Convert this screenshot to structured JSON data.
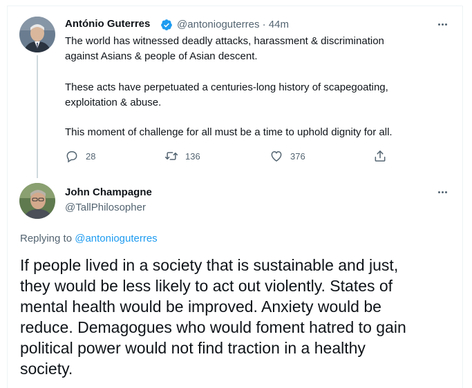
{
  "original_tweet": {
    "author_name": "António Guterres",
    "verified": true,
    "handle_time": "@antonioguterres · 44m",
    "body_lines": [
      "The world has witnessed deadly attacks, harassment & discrimination",
      "against Asians & people of Asian descent.",
      "These acts have perpetuated a centuries-long history of scapegoating,",
      "exploitation & abuse.",
      "This moment of challenge for all must be a time to uphold dignity for all."
    ],
    "actions": {
      "reply_count": "28",
      "retweet_count": "136",
      "like_count": "376"
    }
  },
  "reply_tweet": {
    "author_name": "John Champagne",
    "handle": "@TallPhilosopher",
    "replying_prefix": "Replying to ",
    "replying_to": "@antonioguterres",
    "body_lines": [
      "If people lived in a society that is sustainable and just,",
      "they would be less likely to act out violently. States of",
      "mental health would be improved. Anxiety would be",
      "reduce. Demagogues who would foment hatred to gain",
      "political power would not find traction in a healthy",
      "society."
    ]
  },
  "colors": {
    "text_primary": "#0f1419",
    "text_secondary": "#536471",
    "accent_blue": "#1d9bf0",
    "thread_line": "#cfd9de"
  },
  "icons": {
    "verified": "verified-badge-icon",
    "reply": "reply-icon",
    "retweet": "retweet-icon",
    "like": "heart-icon",
    "share": "share-icon",
    "more": "more-dots-icon"
  }
}
